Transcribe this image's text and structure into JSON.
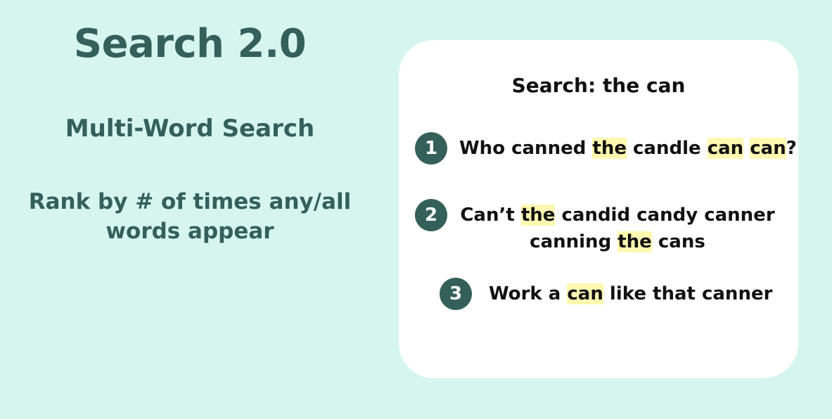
{
  "left": {
    "title": "Search 2.0",
    "subtitle": "Multi-Word Search",
    "description_line1": "Rank by # of times any/all",
    "description_line2": "words appear"
  },
  "card": {
    "query": "Search: the can",
    "highlight_color": "#fff8b0",
    "results": [
      {
        "rank": "1",
        "segments": [
          "Who canned ",
          "the",
          " candle ",
          "can",
          " ",
          "can",
          "?"
        ]
      },
      {
        "rank": "2",
        "line1": [
          "Can’t ",
          "the",
          " candid candy canner"
        ],
        "line2": [
          "canning ",
          "the",
          " cans"
        ]
      },
      {
        "rank": "3",
        "segments": [
          "Work a ",
          "can",
          " like that canner"
        ]
      }
    ]
  },
  "colors": {
    "background": "#d6f5ef",
    "accent": "#35605a",
    "card": "#ffffff"
  }
}
